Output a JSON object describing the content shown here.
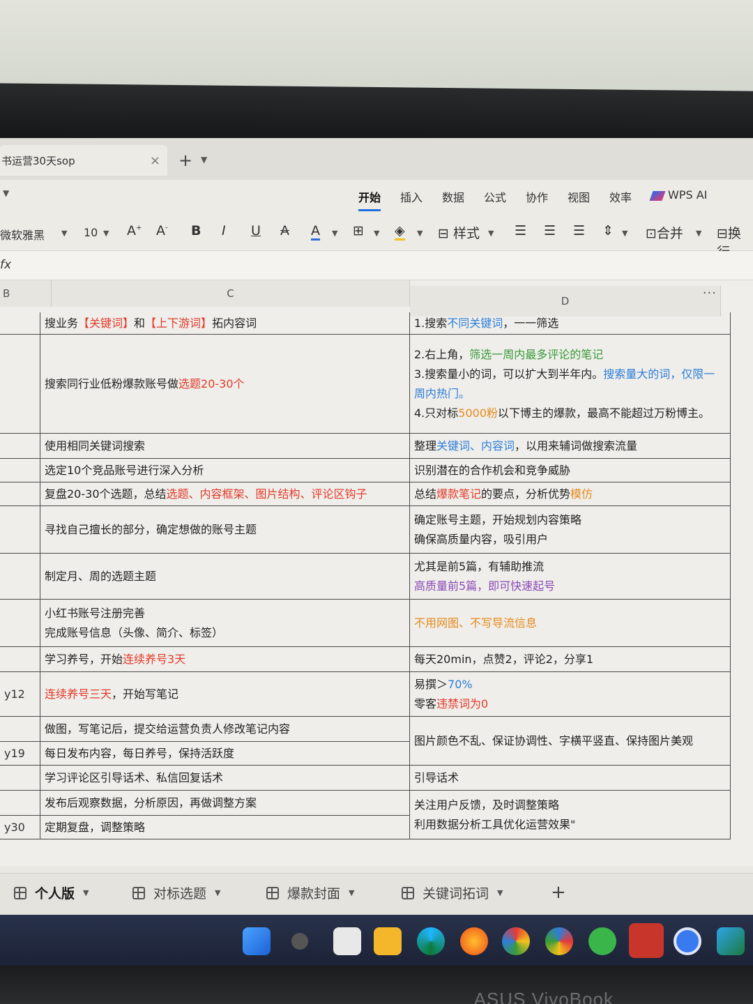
{
  "window": {
    "tab_title": "书运营30天sop",
    "close": "×",
    "new_tab": "+"
  },
  "ribbon": {
    "menus": [
      "开始",
      "插入",
      "数据",
      "公式",
      "协作",
      "视图",
      "效率"
    ],
    "wps_ai": "WPS AI"
  },
  "toolbar": {
    "font_name": "微软雅黑",
    "font_size": "10",
    "grow": "A",
    "shrink": "A",
    "bold": "B",
    "italic": "I",
    "underline": "U",
    "strike": "A",
    "font_color": "A",
    "borders": "⊞",
    "styles": "样式",
    "merge": "合并",
    "wrap": "换行"
  },
  "formula_bar": {
    "fx": "fx"
  },
  "columns": {
    "b": "B",
    "c": "C",
    "d": "D",
    "more": "···"
  },
  "rows": [
    {
      "b": "",
      "c": [
        [
          [
            "搜业务",
            ""
          ],
          [
            "【关键词】",
            "red"
          ],
          [
            "和",
            ""
          ],
          [
            "【上下游词】",
            "red"
          ],
          [
            "拓内容词",
            ""
          ]
        ]
      ],
      "d": [
        [
          [
            "1.搜索",
            ""
          ],
          [
            "不同关键词",
            "blue"
          ],
          [
            "，一一筛选",
            ""
          ]
        ]
      ]
    },
    {
      "b": "",
      "c": [
        [
          [
            "搜索同行业低粉爆款账号做",
            ""
          ],
          [
            "选题20-30个",
            "red"
          ]
        ]
      ],
      "d": [
        [
          [
            "2.右上角，",
            ""
          ],
          [
            "筛选一周内最多评论的笔记",
            "green"
          ]
        ],
        [
          [
            "3.搜索量小的词，可以扩大到半年内。",
            ""
          ],
          [
            "搜索量大的词，仅限一周内热门。",
            "blue"
          ]
        ],
        [
          [
            "4.只对标",
            ""
          ],
          [
            "5000粉",
            "orange"
          ],
          [
            "以下博主的爆款，最高不能超过万粉博主。",
            ""
          ]
        ]
      ]
    },
    {
      "b": "",
      "c": [
        [
          [
            "使用相同关键词搜索",
            ""
          ]
        ]
      ],
      "d": [
        [
          [
            "整理",
            ""
          ],
          [
            "关键词、内容词",
            "blue"
          ],
          [
            "，以用来辅词做搜索流量",
            ""
          ]
        ]
      ]
    },
    {
      "b": "",
      "c": [
        [
          [
            "选定10个竞品账号进行深入分析",
            ""
          ]
        ]
      ],
      "d": [
        [
          [
            "识别潜在的合作机会和竞争威胁",
            ""
          ]
        ]
      ]
    },
    {
      "b": "",
      "c": [
        [
          [
            "复盘20-30个选题，总结",
            ""
          ],
          [
            "选题、内容框架、图片结构、评论区钩子",
            "red"
          ]
        ]
      ],
      "d": [
        [
          [
            "总结",
            ""
          ],
          [
            "爆款笔记",
            "red"
          ],
          [
            "的要点，分析优势",
            ""
          ],
          [
            "模仿",
            "orange"
          ]
        ]
      ]
    },
    {
      "b": "",
      "c": [
        [
          [
            "寻找自己擅长的部分，确定想做的账号主题",
            ""
          ]
        ]
      ],
      "d": [
        [
          [
            "确定账号主题，开始规划内容策略",
            ""
          ]
        ],
        [
          [
            "确保高质量内容，吸引用户",
            ""
          ]
        ]
      ]
    },
    {
      "b": "",
      "c": [
        [
          [
            "制定月、周的选题主题",
            ""
          ]
        ]
      ],
      "d": [
        [
          [
            "尤其是前5篇，有辅助推流",
            ""
          ]
        ],
        [
          [
            "高质量前5篇，即可快速起号",
            "purple"
          ]
        ]
      ]
    },
    {
      "b": "",
      "c": [
        [
          [
            "小红书账号注册完善",
            ""
          ]
        ],
        [
          [
            "完成账号信息（头像、简介、标签）",
            ""
          ]
        ]
      ],
      "d": [
        [
          [
            "不用网图、不写导流信息",
            "orange"
          ]
        ]
      ]
    },
    {
      "b": "",
      "c": [
        [
          [
            "学习养号，开始",
            ""
          ],
          [
            "连续养号3天",
            "red"
          ]
        ]
      ],
      "d": [
        [
          [
            "每天20min，点赞2，评论2，分享1",
            ""
          ]
        ]
      ]
    },
    {
      "b": "y12",
      "c": [
        [
          [
            "连续养号三天",
            "red"
          ],
          [
            "，开始写笔记",
            ""
          ]
        ]
      ],
      "d": [
        [
          [
            "易撰＞",
            ""
          ],
          [
            "70%",
            "blue"
          ]
        ],
        [
          [
            "零客",
            ""
          ],
          [
            "违禁词为0",
            "red"
          ]
        ]
      ]
    },
    {
      "b": "",
      "c": [
        [
          [
            "做图，写笔记后，提交给运营负责人修改笔记内容",
            ""
          ]
        ]
      ],
      "d": []
    },
    {
      "b": "y19",
      "c": [
        [
          [
            "每日发布内容，每日养号，保持活跃度",
            ""
          ]
        ]
      ],
      "d": []
    },
    {
      "b": "",
      "c": [
        [
          [
            "学习评论区引导话术、私信回复话术",
            ""
          ]
        ]
      ],
      "d": [
        [
          [
            "引导话术",
            ""
          ]
        ]
      ]
    },
    {
      "b": "",
      "c": [
        [
          [
            "发布后观察数据，分析原因，再做调整方案",
            ""
          ]
        ]
      ],
      "d": []
    },
    {
      "b": "y30",
      "c": [
        [
          [
            "定期复盘，调整策略",
            ""
          ]
        ]
      ],
      "d": []
    }
  ],
  "merged": {
    "img_rule": "图片颜色不乱、保证协调性、字横平竖直、保持图片美观",
    "feedback1": "关注用户反馈，及时调整策略",
    "feedback2": "利用数据分析工具优化运营效果\""
  },
  "sheets": [
    "个人版",
    "对标选题",
    "爆款封面",
    "关键词拓词"
  ],
  "add_sheet": "+",
  "brand": "ASUS VivoBook"
}
